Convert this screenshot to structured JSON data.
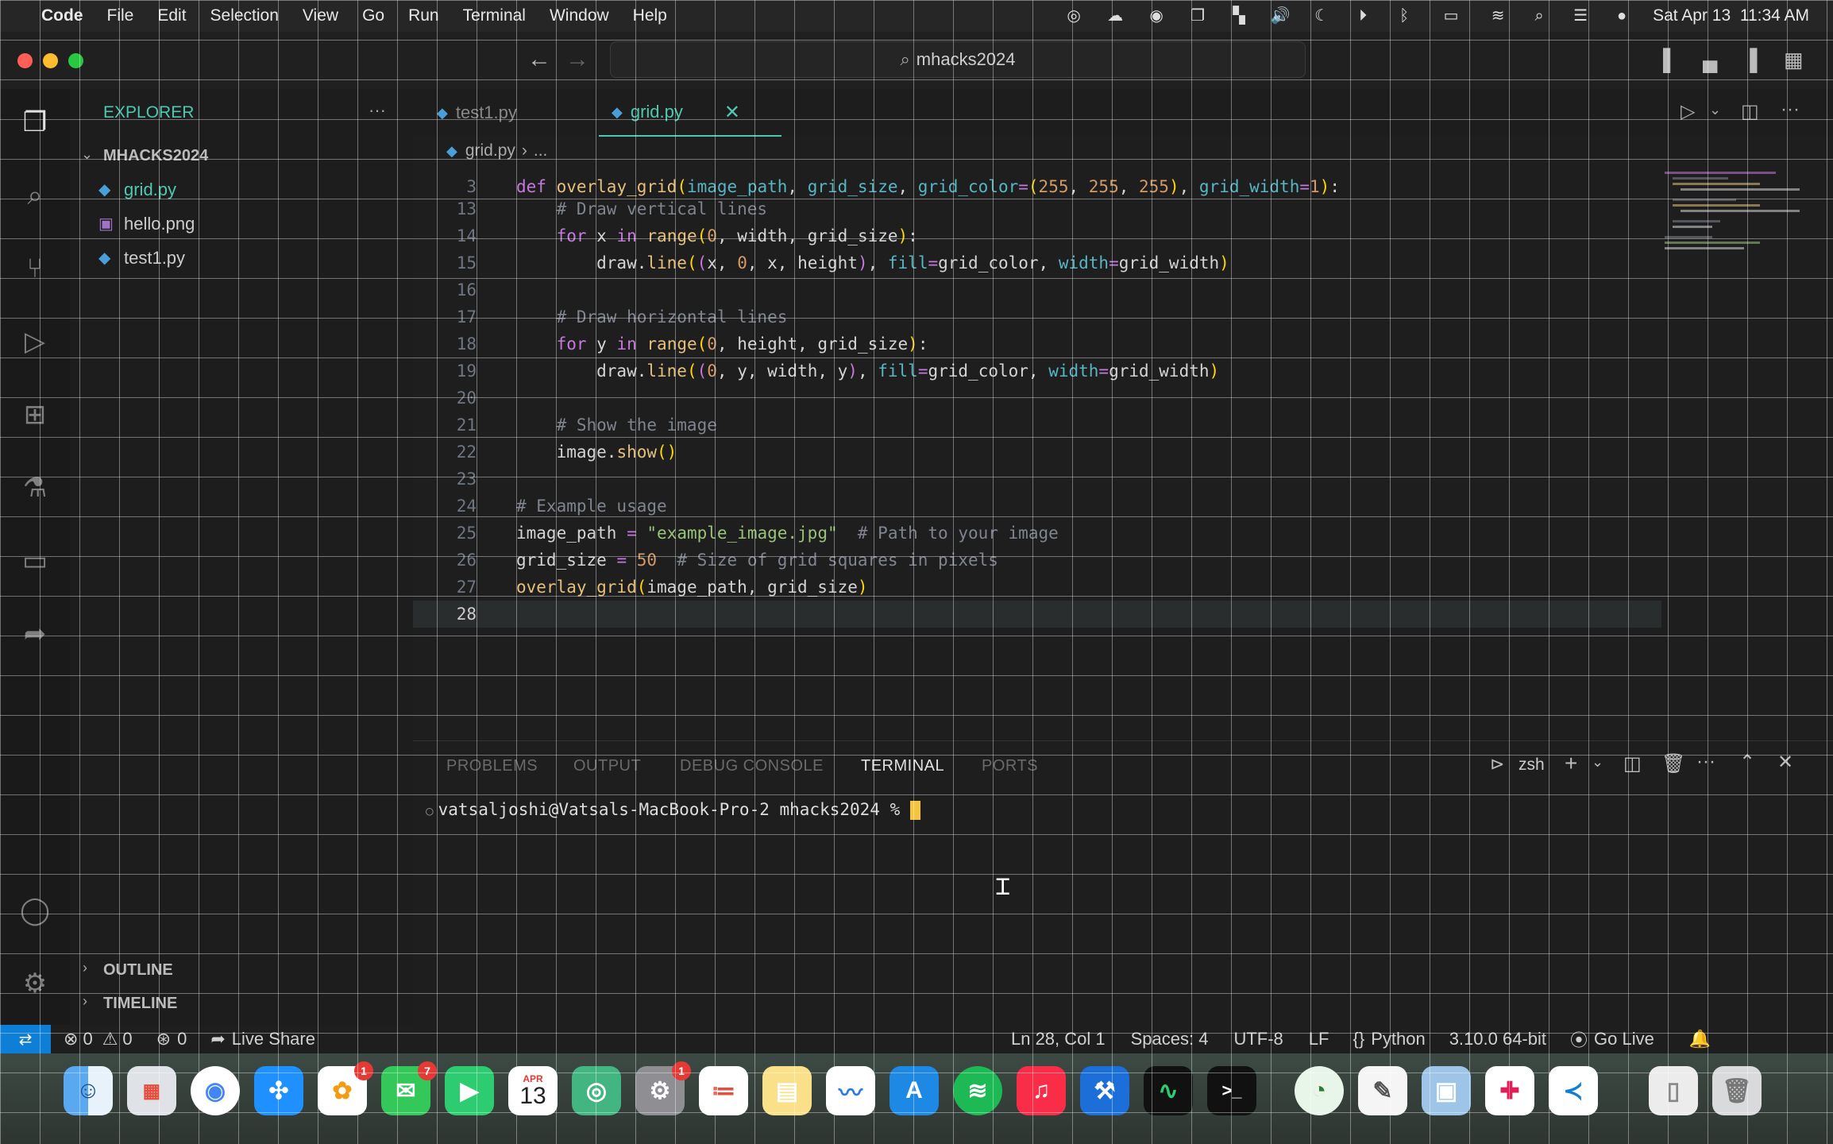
{
  "menubar": {
    "app": "Code",
    "items": [
      "File",
      "Edit",
      "Selection",
      "View",
      "Go",
      "Run",
      "Terminal",
      "Window",
      "Help"
    ],
    "datetime": "Sat Apr 13  11:34 AM"
  },
  "window": {
    "search_text": "mhacks2024"
  },
  "sidebar": {
    "title": "EXPLORER",
    "more": "···",
    "folder": "MHACKS2024",
    "files": [
      "grid.py",
      "hello.png",
      "test1.py"
    ],
    "outline": "OUTLINE",
    "timeline": "TIMELINE"
  },
  "tabs": [
    {
      "label": "test1.py",
      "active": false
    },
    {
      "label": "grid.py",
      "active": true
    }
  ],
  "breadcrumb": {
    "file": "grid.py",
    "rest": "..."
  },
  "editor": {
    "line_numbers": [
      "3",
      "13",
      "14",
      "15",
      "16",
      "17",
      "18",
      "19",
      "20",
      "21",
      "22",
      "23",
      "24",
      "25",
      "26",
      "27",
      "28"
    ],
    "lines": [
      "def overlay_grid(image_path, grid_size, grid_color=(255, 255, 255), grid_width=1):",
      "    # Draw vertical lines",
      "    for x in range(0, width, grid_size):",
      "        draw.line((x, 0, x, height), fill=grid_color, width=grid_width)",
      "",
      "    # Draw horizontal lines",
      "    for y in range(0, height, grid_size):",
      "        draw.line((0, y, width, y), fill=grid_color, width=grid_width)",
      "",
      "    # Show the image",
      "    image.show()",
      "",
      "# Example usage",
      "image_path = \"example_image.jpg\"  # Path to your image",
      "grid_size = 50  # Size of grid squares in pixels",
      "overlay_grid(image_path, grid_size)",
      ""
    ]
  },
  "panel": {
    "tabs": [
      "PROBLEMS",
      "OUTPUT",
      "DEBUG CONSOLE",
      "TERMINAL",
      "PORTS"
    ],
    "active_tab": "TERMINAL",
    "shell": "zsh",
    "prompt": "vatsaljoshi@Vatsals-MacBook-Pro-2 mhacks2024 % "
  },
  "statusbar": {
    "errors": "0",
    "warnings": "0",
    "ports": "0",
    "live_share": "Live Share",
    "position": "Ln 28, Col 1",
    "spaces": "Spaces: 4",
    "encoding": "UTF-8",
    "eol": "LF",
    "language": "Python",
    "interpreter": "3.10.0 64-bit",
    "go_live": "Go Live"
  },
  "dock": {
    "calendar_month": "APR",
    "calendar_day": "13",
    "photos_badge": "1",
    "messages_badge": "7",
    "settings_badge": "1"
  },
  "colors": {
    "accent": "#0e7fd6",
    "tab_active": "#4ec9b0",
    "grid_overlay": "#ffffff"
  }
}
